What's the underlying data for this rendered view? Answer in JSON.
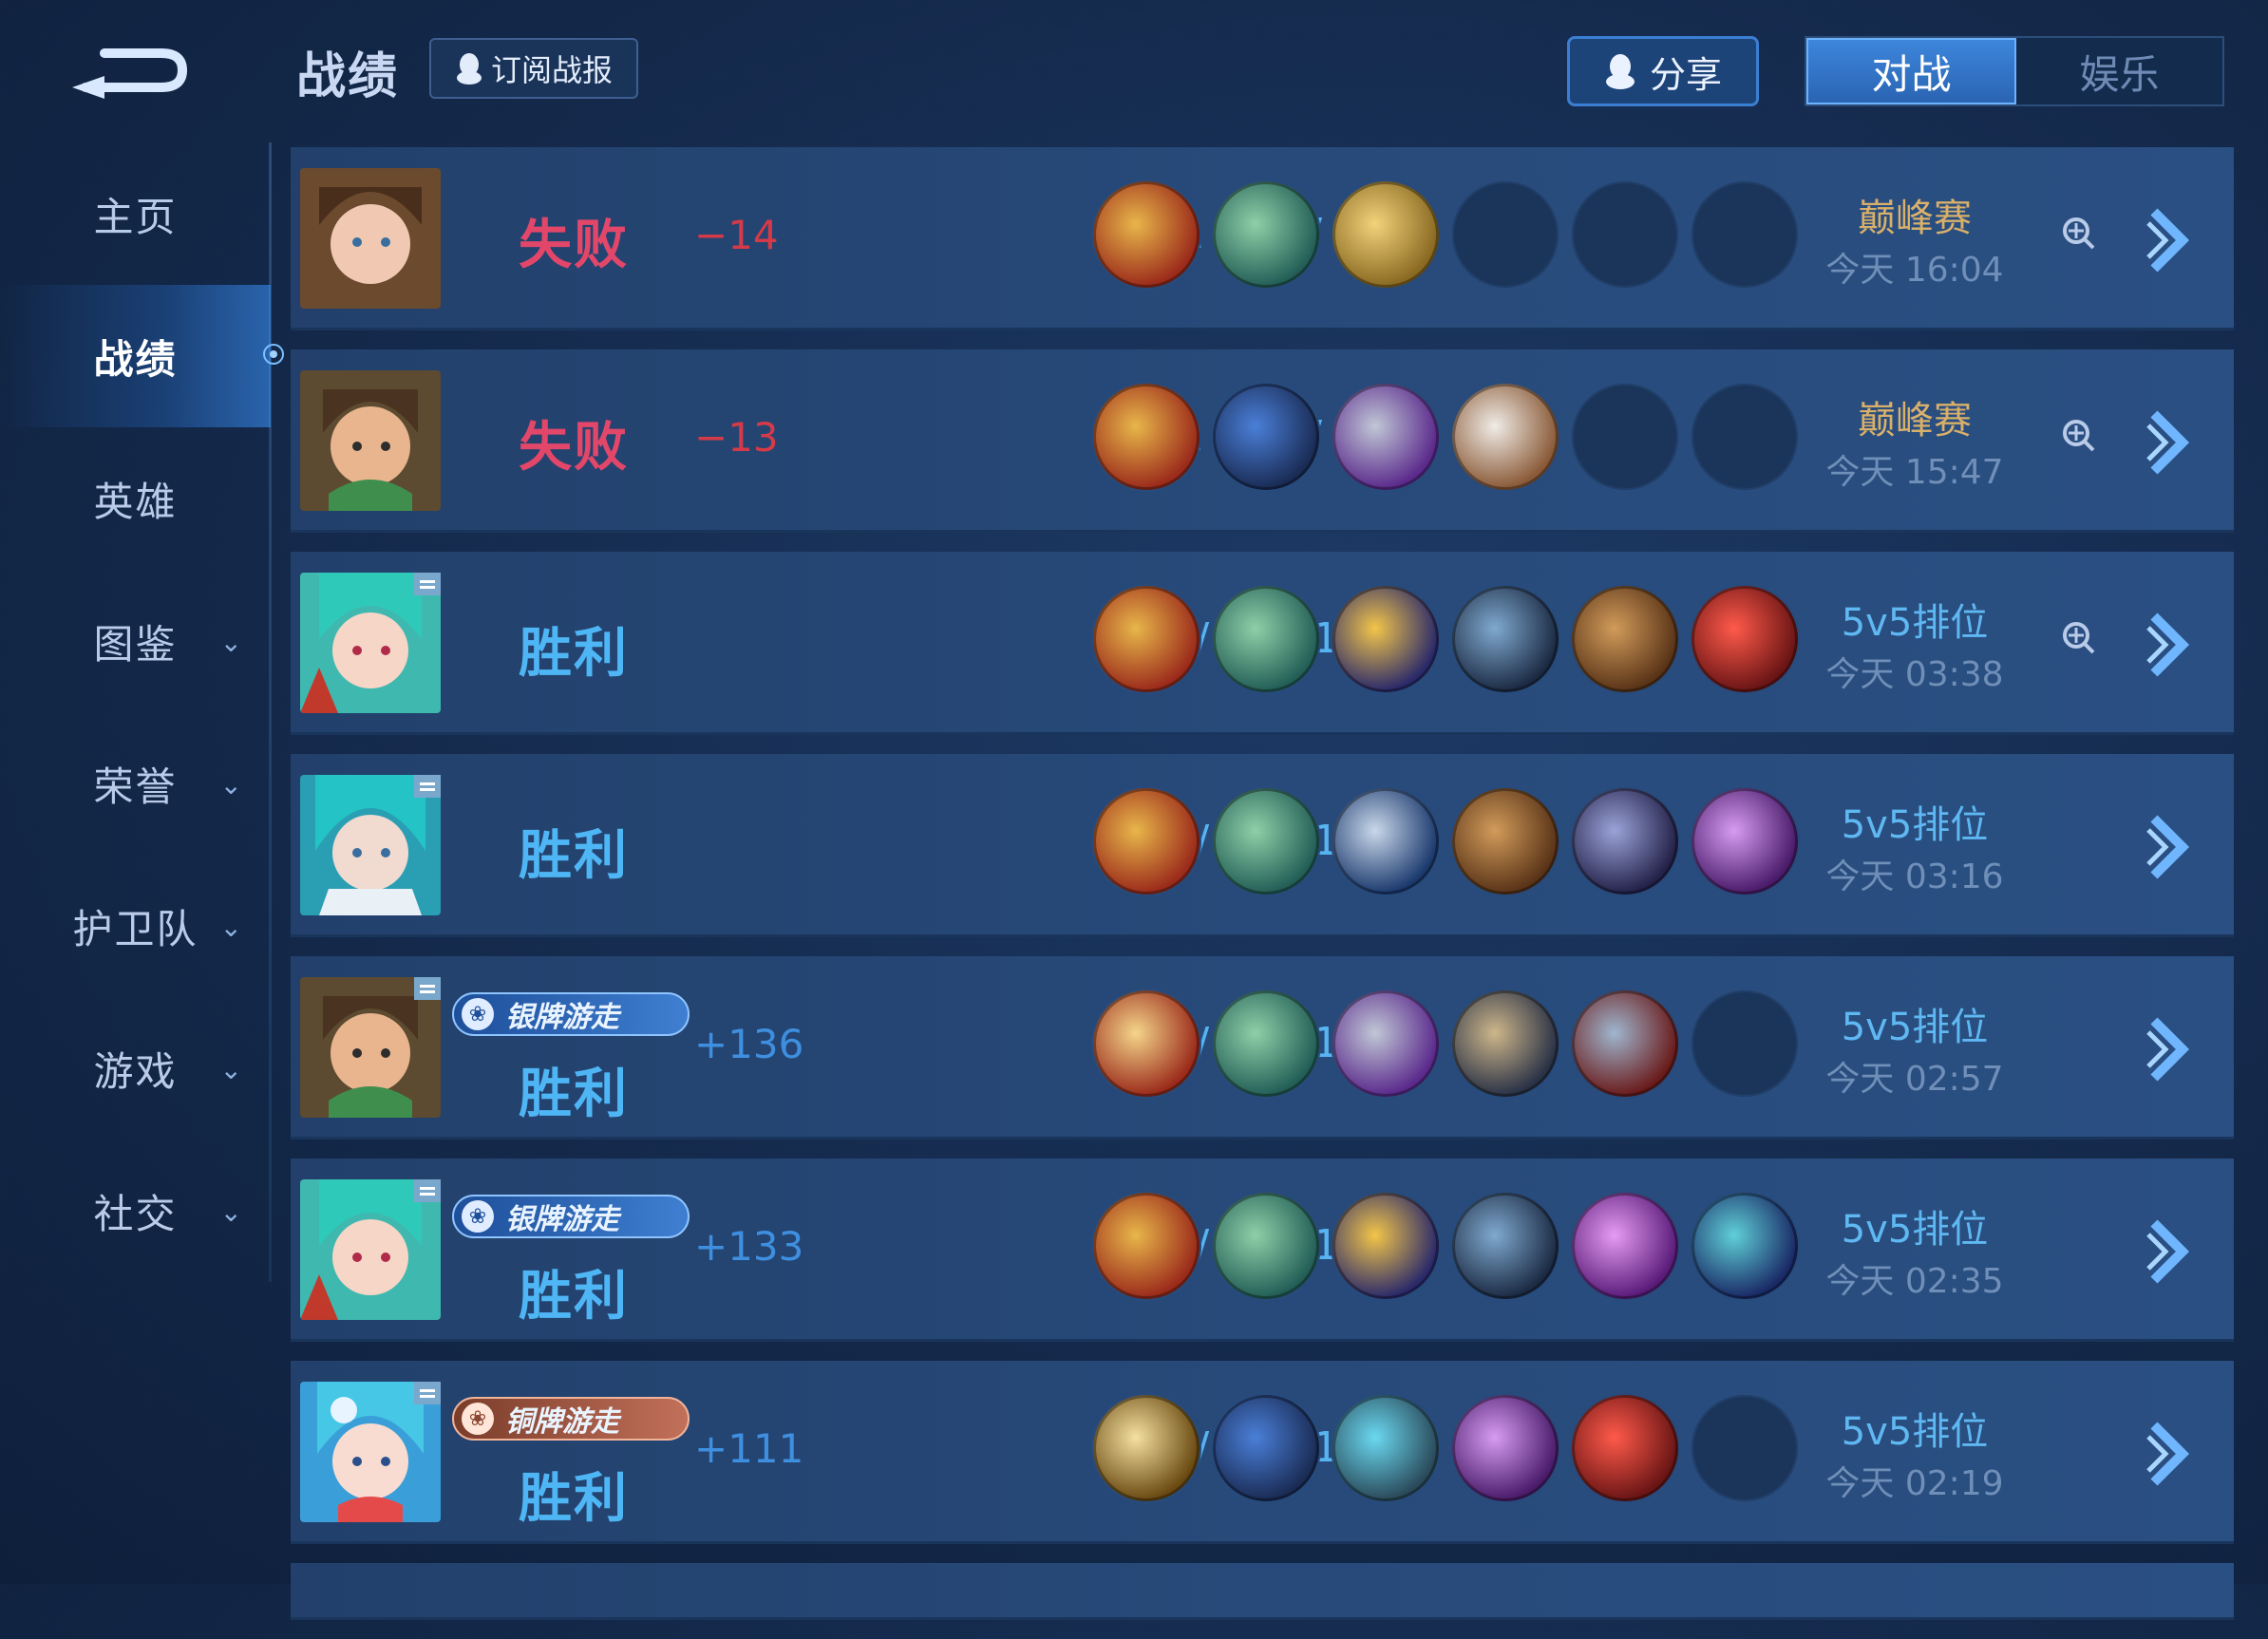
{
  "header": {
    "title": "战绩",
    "subscribe_label": "订阅战报",
    "share_label": "分享",
    "tabs": [
      {
        "label": "对战",
        "active": true
      },
      {
        "label": "娱乐",
        "active": false
      }
    ]
  },
  "sidebar": {
    "items": [
      {
        "label": "主页"
      },
      {
        "label": "战绩"
      },
      {
        "label": "英雄"
      },
      {
        "label": "图鉴"
      },
      {
        "label": "荣誉"
      },
      {
        "label": "护卫队"
      },
      {
        "label": "游戏"
      },
      {
        "label": "社交"
      }
    ]
  },
  "matches": [
    {
      "result": "失败",
      "delta": "−14",
      "kda": "1 / 2 / 1",
      "mode": "巅峰赛",
      "time": "今天 16:04",
      "rank_badge": ""
    },
    {
      "result": "失败",
      "delta": "−13",
      "kda": "2 / 3 / 3",
      "mode": "巅峰赛",
      "time": "今天 15:47",
      "rank_badge": ""
    },
    {
      "result": "胜利",
      "delta": "",
      "kda": "1 / 5 / 13",
      "mode": "5v5排位",
      "time": "今天 03:38",
      "rank_badge": ""
    },
    {
      "result": "胜利",
      "delta": "",
      "kda": "2 / 2 / 10",
      "mode": "5v5排位",
      "time": "今天 03:16",
      "rank_badge": ""
    },
    {
      "result": "胜利",
      "delta": "+136",
      "kda": "2 / 3 / 16",
      "mode": "5v5排位",
      "time": "今天 02:57",
      "rank_badge": "银牌游走"
    },
    {
      "result": "胜利",
      "delta": "+133",
      "kda": "1 / 3 / 18",
      "mode": "5v5排位",
      "time": "今天 02:35",
      "rank_badge": "银牌游走"
    },
    {
      "result": "胜利",
      "delta": "+111",
      "kda": "1 / 1 / 14",
      "mode": "5v5排位",
      "time": "今天 02:19",
      "rank_badge": "铜牌游走"
    }
  ],
  "colors": {
    "lose": "#e2476a",
    "win": "#4fb6f5",
    "peak_mode": "#d9b06a",
    "accent": "#3d86dc"
  },
  "icons": {
    "back": "back-arrow-icon",
    "subscribe": "qq-penguin-icon",
    "share": "qq-penguin-icon",
    "mvp": "crosshair-icon",
    "detail": "chevron-right-icon"
  }
}
